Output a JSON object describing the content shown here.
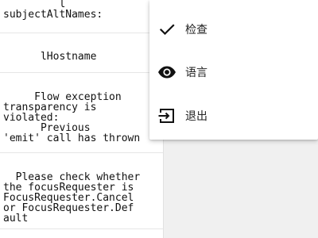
{
  "list": {
    "rows": [
      {
        "text": "         l\nsubjectAltNames:"
      },
      {
        "text": "      lHostname"
      },
      {
        "text": "     Flow exception\ntransparency is\nviolated:\n      Previous\n'emit' call has thrown"
      },
      {
        "text": "  Please check whether\nthe focusRequester is\nFocusRequester.Cancel\nor FocusRequester.Def\nault"
      },
      {
        "text": ""
      }
    ]
  },
  "menu": {
    "items": [
      {
        "label": "检查",
        "icon": "check-icon"
      },
      {
        "label": "语言",
        "icon": "eye-icon"
      },
      {
        "label": "退出",
        "icon": "exit-icon"
      }
    ]
  },
  "colors": {
    "icon": "#111111",
    "menu_background": "#ffffff",
    "dim_background": "#f0f0f0"
  }
}
